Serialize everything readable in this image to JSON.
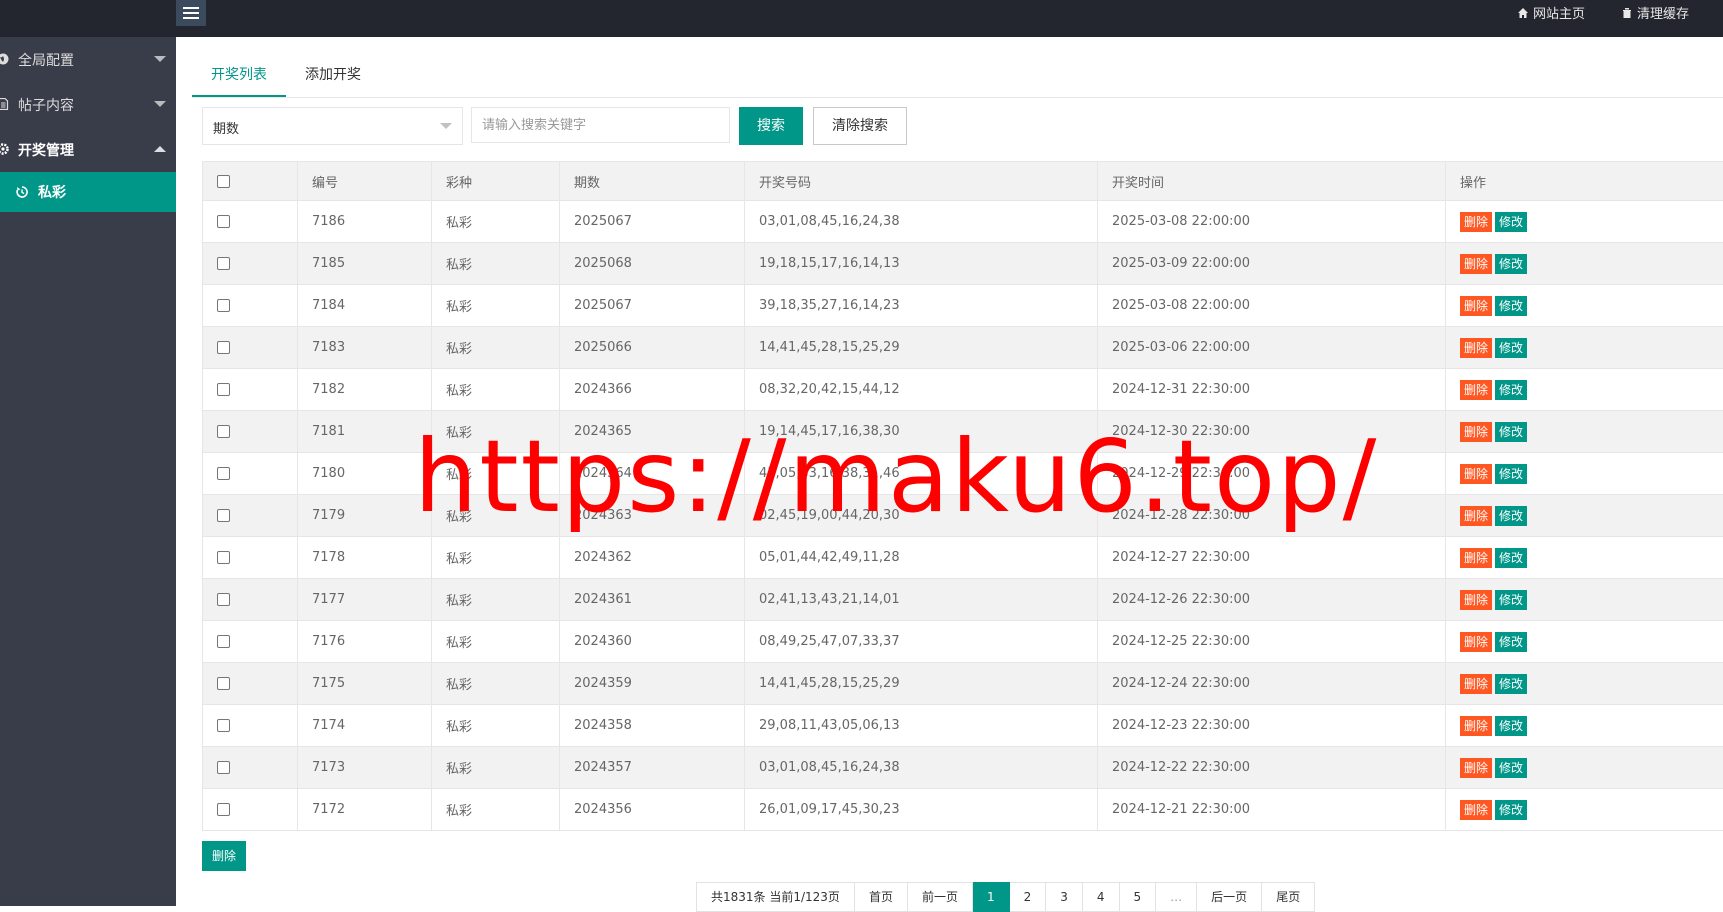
{
  "topbar": {
    "links": [
      {
        "label": "网站主页",
        "icon": "home-icon"
      },
      {
        "label": "清理缓存",
        "icon": "trash-icon"
      }
    ]
  },
  "sidebar": {
    "items": [
      {
        "label": "全局配置",
        "icon": "globe-icon",
        "expanded": false
      },
      {
        "label": "帖子内容",
        "icon": "document-icon",
        "expanded": false
      },
      {
        "label": "开奖管理",
        "icon": "gear-icon",
        "expanded": true
      }
    ],
    "sub_item": {
      "label": "私彩",
      "icon": "history-icon"
    }
  },
  "tabs": [
    {
      "label": "开奖列表",
      "active": true
    },
    {
      "label": "添加开奖",
      "active": false
    }
  ],
  "search": {
    "field_selected": "期数",
    "placeholder": "请输入搜索关键字",
    "search_label": "搜索",
    "clear_label": "清除搜索"
  },
  "table": {
    "headers": [
      "编号",
      "彩种",
      "期数",
      "开奖号码",
      "开奖时间",
      "操作"
    ],
    "delete_label": "删除",
    "edit_label": "修改",
    "rows": [
      [
        "7186",
        "私彩",
        "2025067",
        "03,01,08,45,16,24,38",
        "2025-03-08 22:00:00"
      ],
      [
        "7185",
        "私彩",
        "2025068",
        "19,18,15,17,16,14,13",
        "2025-03-09 22:00:00"
      ],
      [
        "7184",
        "私彩",
        "2025067",
        "39,18,35,27,16,14,23",
        "2025-03-08 22:00:00"
      ],
      [
        "7183",
        "私彩",
        "2025066",
        "14,41,45,28,15,25,29",
        "2025-03-06 22:00:00"
      ],
      [
        "7182",
        "私彩",
        "2024366",
        "08,32,20,42,15,44,12",
        "2024-12-31 22:30:00"
      ],
      [
        "7181",
        "私彩",
        "2024365",
        "19,14,45,17,16,38,30",
        "2024-12-30 22:30:00"
      ],
      [
        "7180",
        "私彩",
        "2024364",
        "43,05,33,16,38,31,46",
        "2024-12-29 22:30:00"
      ],
      [
        "7179",
        "私彩",
        "2024363",
        "02,45,19,00,44,20,30",
        "2024-12-28 22:30:00"
      ],
      [
        "7178",
        "私彩",
        "2024362",
        "05,01,44,42,49,11,28",
        "2024-12-27 22:30:00"
      ],
      [
        "7177",
        "私彩",
        "2024361",
        "02,41,13,43,21,14,01",
        "2024-12-26 22:30:00"
      ],
      [
        "7176",
        "私彩",
        "2024360",
        "08,49,25,47,07,33,37",
        "2024-12-25 22:30:00"
      ],
      [
        "7175",
        "私彩",
        "2024359",
        "14,41,45,28,15,25,29",
        "2024-12-24 22:30:00"
      ],
      [
        "7174",
        "私彩",
        "2024358",
        "29,08,11,43,05,06,13",
        "2024-12-23 22:30:00"
      ],
      [
        "7173",
        "私彩",
        "2024357",
        "03,01,08,45,16,24,38",
        "2024-12-22 22:30:00"
      ],
      [
        "7172",
        "私彩",
        "2024356",
        "26,01,09,17,45,30,23",
        "2024-12-21 22:30:00"
      ]
    ]
  },
  "bulk_delete_label": "删除",
  "pagination": {
    "summary": "共1831条 当前1/123页",
    "first": "首页",
    "prev": "前一页",
    "pages": [
      "1",
      "2",
      "3",
      "4",
      "5"
    ],
    "current": "1",
    "dots": "…",
    "next": "后一页",
    "last": "尾页"
  },
  "watermark": "https://maku6.top/",
  "colors": {
    "accent": "#009688",
    "danger": "#ff5722",
    "sidebar": "#393d49",
    "topbar": "#23262e"
  }
}
